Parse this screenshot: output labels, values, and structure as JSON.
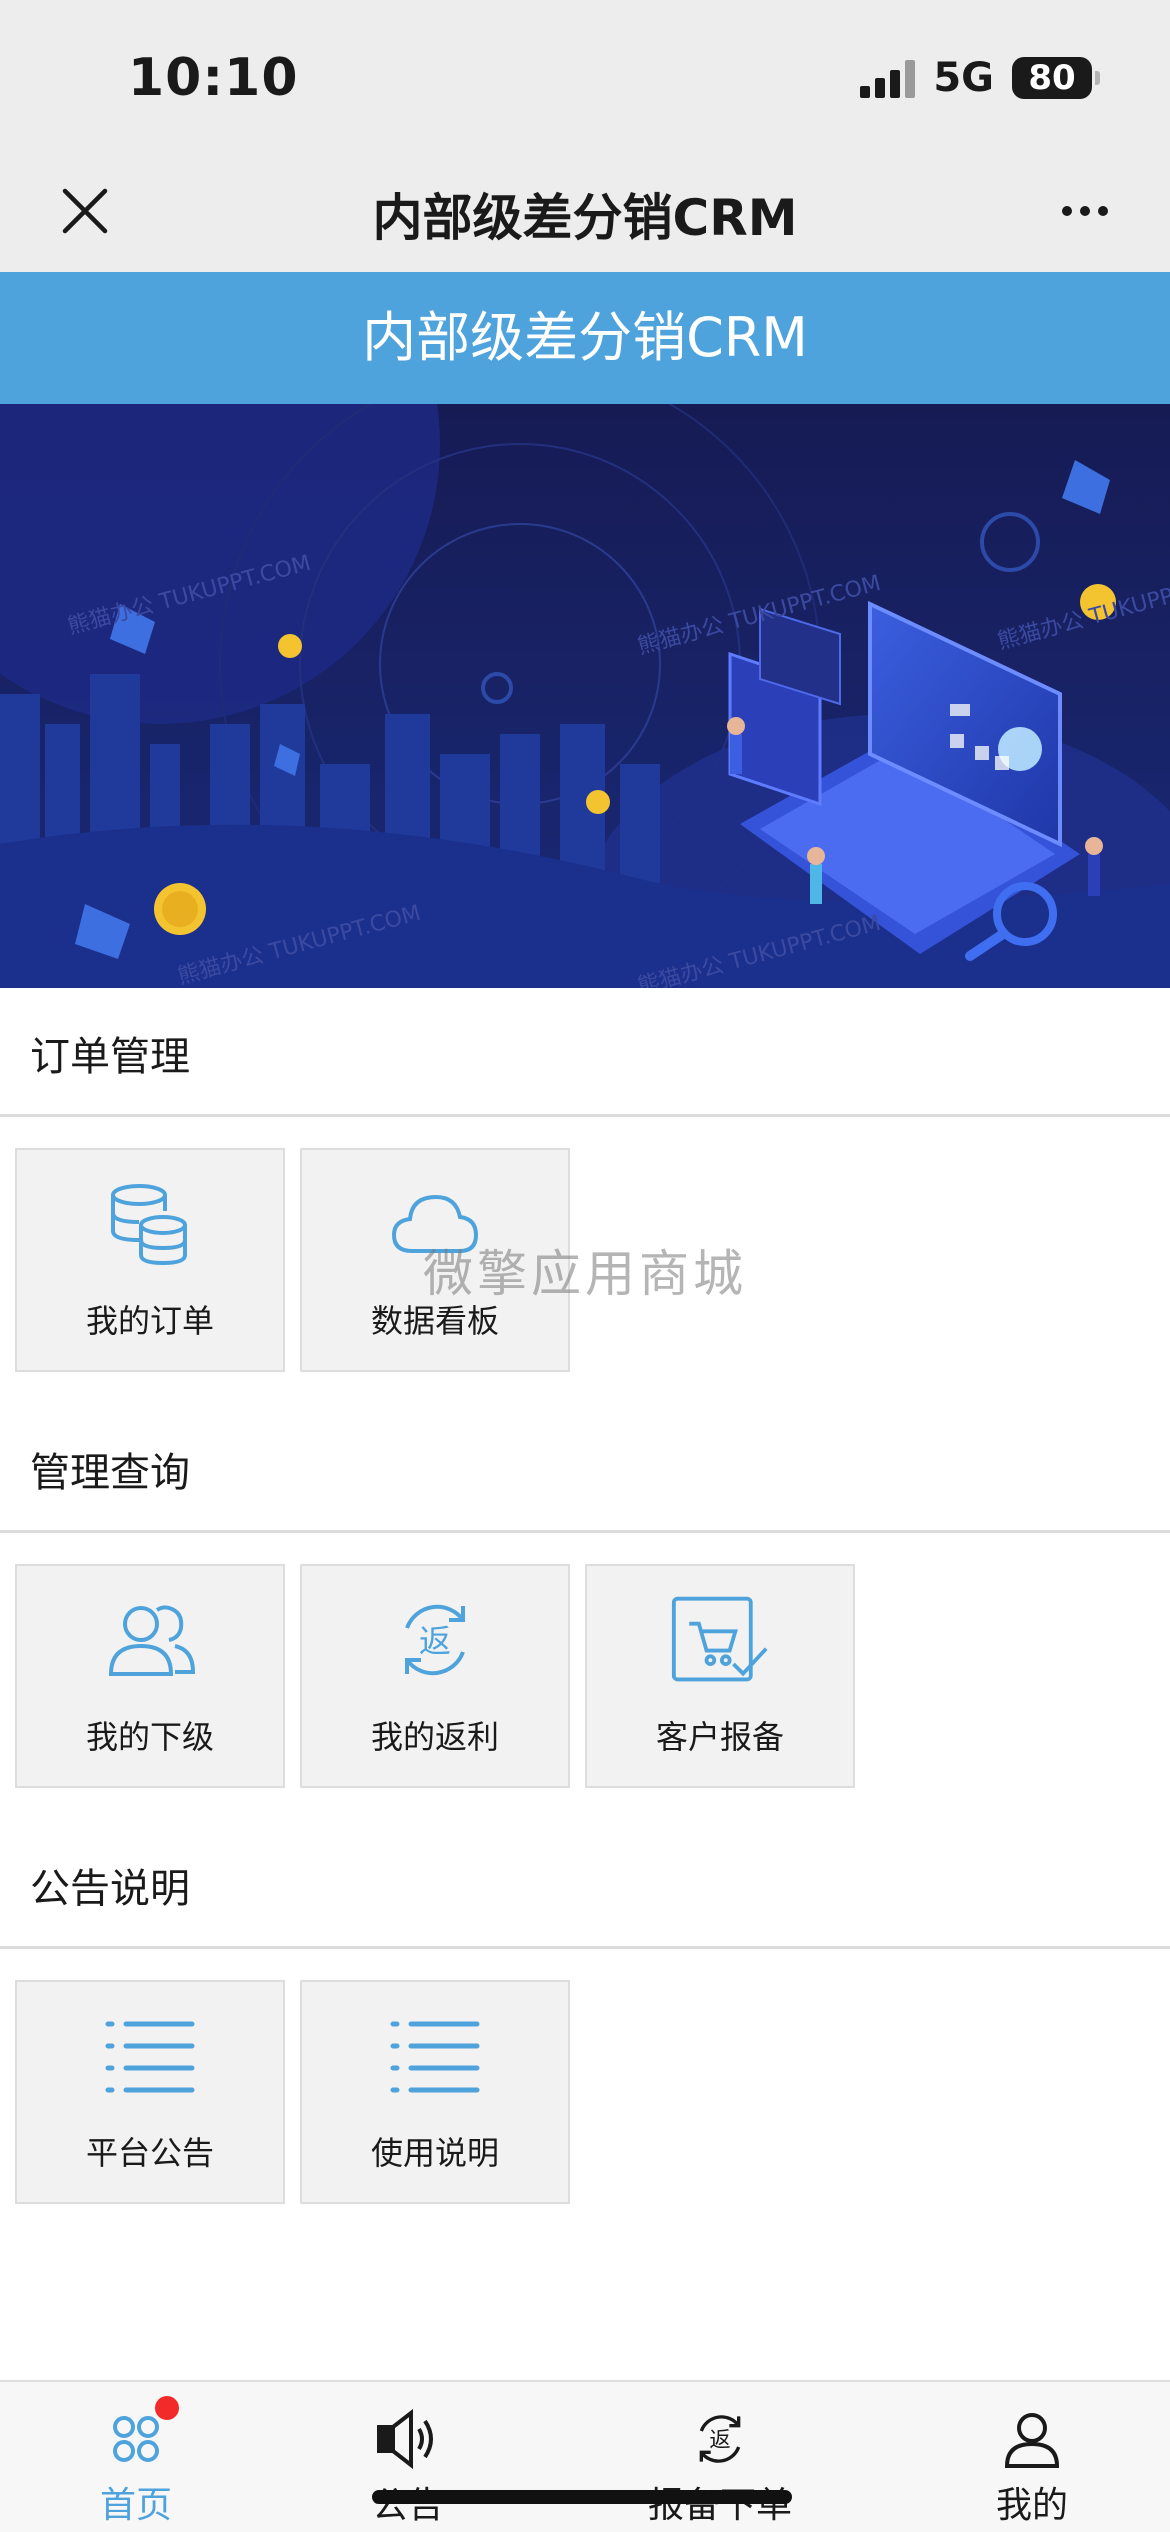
{
  "status_bar": {
    "time": "10:10",
    "network": "5G",
    "battery": "80"
  },
  "nav": {
    "title": "内部级差分销CRM",
    "close_icon": "close-icon",
    "more_icon": "more-icon"
  },
  "header": {
    "title": "内部级差分销CRM"
  },
  "banner": {
    "watermark_text": "熊猫办公 TUKUPPT.COM"
  },
  "sections": [
    {
      "title": "订单管理",
      "tiles": [
        {
          "label": "我的订单",
          "icon": "database-icon"
        },
        {
          "label": "数据看板",
          "icon": "cloud-icon"
        }
      ]
    },
    {
      "title": "管理查询",
      "tiles": [
        {
          "label": "我的下级",
          "icon": "users-icon"
        },
        {
          "label": "我的返利",
          "icon": "rebate-icon"
        },
        {
          "label": "客户报备",
          "icon": "cart-check-icon"
        }
      ]
    },
    {
      "title": "公告说明",
      "tiles": [
        {
          "label": "平台公告",
          "icon": "list-icon"
        },
        {
          "label": "使用说明",
          "icon": "list-icon"
        }
      ]
    }
  ],
  "watermark": "微擎应用商城",
  "tab_bar": {
    "tabs": [
      {
        "label": "首页",
        "icon": "home-grid-icon",
        "active": true,
        "badge": true
      },
      {
        "label": "公告",
        "icon": "speaker-icon",
        "active": false
      },
      {
        "label": "报备下单",
        "icon": "rebate-icon",
        "active": false
      },
      {
        "label": "我的",
        "icon": "user-icon",
        "active": false
      }
    ]
  },
  "colors": {
    "accent": "#4fa3dd",
    "badge": "#f22a2a",
    "banner_bg": "#161b54"
  }
}
